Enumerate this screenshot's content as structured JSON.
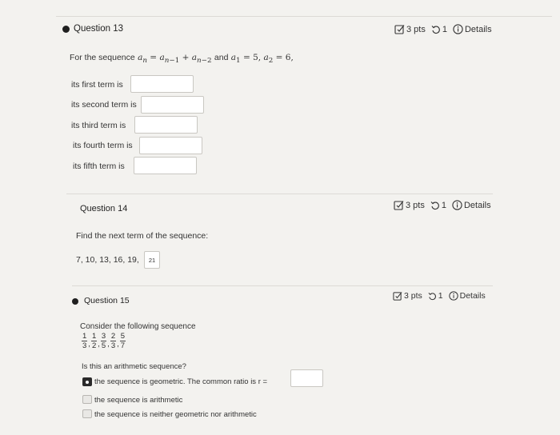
{
  "icons": {
    "points": "edit-square-icon",
    "attempts": "retry-icon",
    "details": "info-circle-icon"
  },
  "q13": {
    "title": "Question 13",
    "points": "3 pts",
    "attempts": "1",
    "details": "Details",
    "prompt_prefix": "For the sequence",
    "prompt_and": "and",
    "terms": [
      {
        "label": "its first term is",
        "value": ""
      },
      {
        "label": "its second term is",
        "value": ""
      },
      {
        "label": "its third term is",
        "value": ""
      },
      {
        "label": "its fourth term is",
        "value": ""
      },
      {
        "label": "its fifth term is",
        "value": ""
      }
    ]
  },
  "q14": {
    "title": "Question 14",
    "points": "3 pts",
    "attempts": "1",
    "details": "Details",
    "prompt": "Find the next term of the sequence:",
    "sequence": "7, 10, 13, 16, 19,",
    "answer": "21"
  },
  "q15": {
    "title": "Question 15",
    "points": "3 pts",
    "attempts": "1",
    "details": "Details",
    "prompt": "Consider the following sequence",
    "fractions": [
      {
        "num": "1",
        "den": "3"
      },
      {
        "num": "1",
        "den": "2"
      },
      {
        "num": "3",
        "den": "5"
      },
      {
        "num": "2",
        "den": "3"
      },
      {
        "num": "5",
        "den": "7"
      }
    ],
    "question": "Is this an arithmetic sequence?",
    "options": [
      {
        "label": "the sequence is geometric. The common ratio is r =",
        "selected": true
      },
      {
        "label": "the sequence is arithmetic",
        "selected": false
      },
      {
        "label": "the sequence is neither geometric nor arithmetic",
        "selected": false
      }
    ]
  }
}
